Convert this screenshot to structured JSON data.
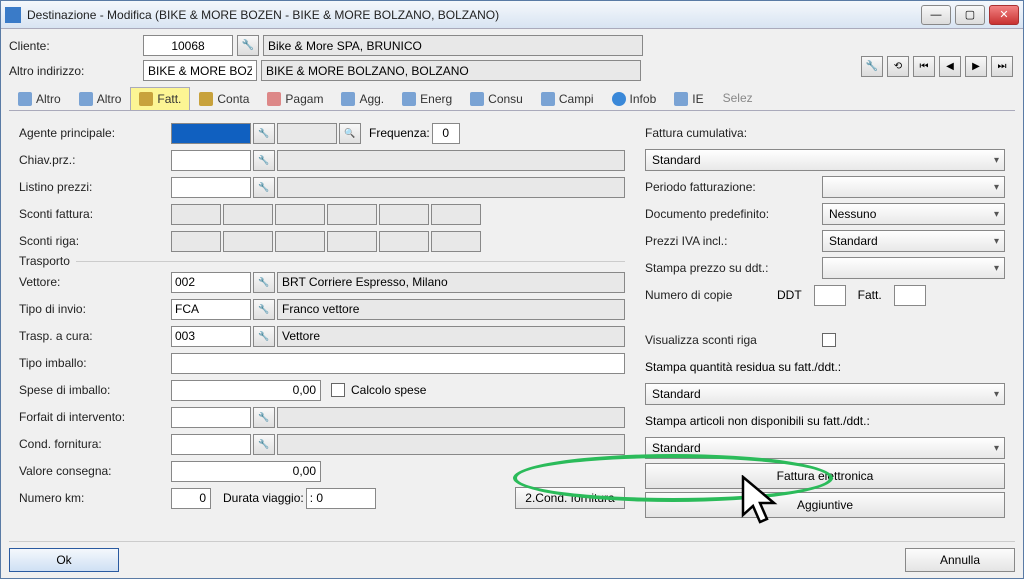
{
  "window": {
    "title": "Destinazione - Modifica (BIKE & MORE BOZEN - BIKE & MORE BOLZANO, BOLZANO)"
  },
  "header": {
    "cliente_label": "Cliente:",
    "cliente_code": "10068",
    "cliente_name": "Bike & More SPA, BRUNICO",
    "altro_label": "Altro indirizzo:",
    "altro_code": "BIKE & MORE BOZ",
    "altro_name": "BIKE & MORE BOLZANO, BOLZANO"
  },
  "tabs": [
    "Altro",
    "Altro",
    "Fatt.",
    "Conta",
    "Pagam",
    "Agg.",
    "Energ",
    "Consu",
    "Campi",
    "Infob",
    "IE"
  ],
  "tabs_extra": "Selez",
  "left": {
    "agente_label": "Agente principale:",
    "chiav_label": "Chiav.prz.:",
    "listino_label": "Listino prezzi:",
    "sconti_fatt_label": "Sconti fattura:",
    "sconti_riga_label": "Sconti riga:",
    "frequenza_label": "Frequenza:",
    "frequenza_val": "0",
    "trasporto_groupbox": "Trasporto",
    "vettore_label": "Vettore:",
    "vettore_code": "002",
    "vettore_desc": "BRT Corriere Espresso, Milano",
    "tipo_invio_label": "Tipo di invio:",
    "tipo_invio_code": "FCA",
    "tipo_invio_desc": "Franco vettore",
    "trasp_cura_label": "Trasp. a cura:",
    "trasp_cura_code": "003",
    "trasp_cura_desc": "Vettore",
    "tipo_imballo_label": "Tipo imballo:",
    "spese_imballo_label": "Spese di imballo:",
    "spese_imballo_val": "0,00",
    "calcolo_spese_label": "Calcolo spese",
    "forfait_label": "Forfait di intervento:",
    "cond_forn_label": "Cond. fornitura:",
    "valore_consegna_label": "Valore consegna:",
    "valore_consegna_val": "0,00",
    "numero_km_label": "Numero km:",
    "numero_km_val": "0",
    "durata_label": "Durata viaggio:",
    "durata_val": ": 0",
    "cond_forn_btn": "2.Cond. fornitura"
  },
  "right": {
    "fatt_cum_label": "Fattura cumulativa:",
    "fatt_cum_val": "Standard",
    "periodo_label": "Periodo fatturazione:",
    "doc_pred_label": "Documento predefinito:",
    "doc_pred_val": "Nessuno",
    "prezzi_iva_label": "Prezzi IVA incl.:",
    "prezzi_iva_val": "Standard",
    "stampa_prezzo_label": "Stampa prezzo su ddt.:",
    "num_copie_label": "Numero di copie",
    "ddt_label": "DDT",
    "fatt_label": "Fatt.",
    "vis_sconti_label": "Visualizza sconti riga",
    "stampa_qta_label": "Stampa quantità residua su fatt./ddt.:",
    "stampa_qta_val": "Standard",
    "stampa_art_label": "Stampa articoli non disponibili su fatt./ddt.:",
    "stampa_art_val": "Standard",
    "fattura_elettronica_btn": "Fattura elettronica",
    "aggiuntive_btn": "Aggiuntive"
  },
  "footer": {
    "ok": "Ok",
    "annulla": "Annulla"
  }
}
